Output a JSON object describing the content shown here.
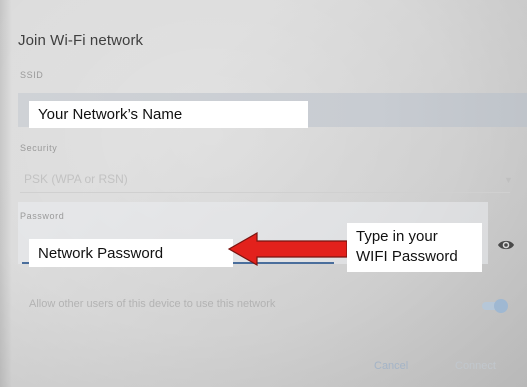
{
  "dialog": {
    "title": "Join Wi-Fi network"
  },
  "ssid": {
    "label": "SSID",
    "callout": "Your Network’s Name"
  },
  "security": {
    "label": "Security",
    "value": "PSK (WPA or RSN)",
    "dropdown_icon": "dropdown-arrow-icon"
  },
  "password": {
    "label": "Password",
    "callout": "Network Password",
    "reveal_icon": "eye-icon"
  },
  "annotation": {
    "line1": "Type in your",
    "line2": "WIFI Password",
    "arrow_color": "#e3211c"
  },
  "allow_other_users": {
    "label": "Allow other users of this device to use this network",
    "toggle_on": true
  },
  "actions": {
    "cancel": "Cancel",
    "connect": "Connect"
  },
  "colors": {
    "accent": "#4a6e9c",
    "toggle": "#9fb8d2"
  }
}
